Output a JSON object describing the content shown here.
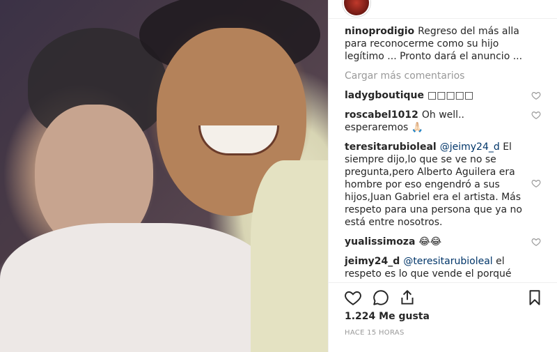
{
  "post": {
    "caption": {
      "user": "ninoprodigio",
      "text": "Regreso del más alla para reconocerme como su hijo legítimo ... Pronto dará el anuncio ..."
    },
    "load_more_label": "Cargar más comentarios",
    "comments": [
      {
        "user": "ladygboutique",
        "text": "□□□□□"
      },
      {
        "user": "roscabel1012",
        "text": "Oh well.. esperaremos 🙏🏻"
      },
      {
        "user": "teresitarubioleal",
        "mention": "@jeimy24_d",
        "text": " El siempre dijo,lo que se ve no se pregunta,pero Alberto Aguilera era hombre por eso engendró a sus hijos,Juan Gabriel era el artista. Más respeto para una persona que ya no está entre nosotros."
      },
      {
        "user": "yualissimoza",
        "text": "😂😂"
      },
      {
        "user": "jeimy24_d",
        "mention": "@teresitarubioleal",
        "text": " el respeto es lo que vende el porqué para ser gay hijos si tuvo... Doble moral es"
      }
    ],
    "likes_label": "1.224 Me gusta",
    "time_label": "HACE 15 HORAS"
  },
  "icons": {
    "like": "heart-icon",
    "comment": "speech-bubble-icon",
    "share": "share-icon",
    "save": "bookmark-icon"
  },
  "colors": {
    "text": "#262626",
    "muted": "#999999",
    "mention": "#003569",
    "border": "#efefef"
  }
}
